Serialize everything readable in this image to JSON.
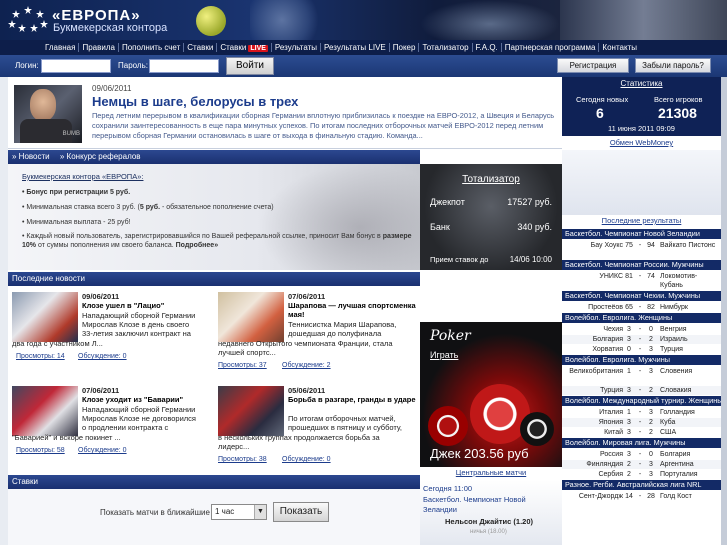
{
  "header": {
    "logo_title": "«ЕВРОПА»",
    "logo_sub": "Букмекерская контора"
  },
  "nav": {
    "items": [
      "Главная",
      "Правила",
      "Пополнить счет",
      "Ставки",
      "Ставки",
      "Результаты",
      "Результаты LIVE",
      "Покер",
      "Тотализатор",
      "F.A.Q.",
      "Партнерская программа",
      "Контакты"
    ],
    "live_badge": "LIVE"
  },
  "login": {
    "login_label": "Логин:",
    "password_label": "Пароль:",
    "submit": "Войти",
    "register": "Регистрация",
    "forgot": "Забыли пароль?"
  },
  "featured": {
    "date": "09/06/2011",
    "title": "Немцы в шаге, белорусы в трех",
    "text": "Перед летним перерывом в квалификации сборная Германии вплотную приблизилась к поездке на ЕВРО-2012, а Швеция и Беларусь сохранили заинтересованность в еще пара минутных успехов. По итогам последних отборочных матчей ЕВРО-2012 перед летним перерывом сборная Германии остановилась в шаге от выхода в финальную стадию. Команда...",
    "img_text": "BUMB"
  },
  "tabs": [
    "» Новости",
    "» Конкурс рефералов"
  ],
  "promo": {
    "title": "Букмекерская контора «ЕВРОПА»:",
    "line1": "• Бонус при регистрации 5 руб.",
    "line2a": "• Минимальная ставка всего 3 руб. (",
    "line2b": "5 руб.",
    "line2c": " - обязательное пополнение счета)",
    "line3": "• Минимальная выплата - 25 руб!",
    "line4a": "• Каждый новый пользователь, зарегистрировавшийся по Вашей реферальной ссылке, приносит Вам бонус в ",
    "line4b": "размере 10%",
    "line4c": " от суммы пополнения им своего баланса. ",
    "line4d": "Подробнее»"
  },
  "totalizator": {
    "title": "Тотализатор",
    "jackpot_label": "Джекпот",
    "jackpot_value": "17527 руб.",
    "bank_label": "Банк",
    "bank_value": "340 руб.",
    "accept_label": "Прием ставок до",
    "accept_value": "14/06 10:00"
  },
  "news_bar": "Последние новости",
  "news": [
    {
      "date": "09/06/2011",
      "title": "Клозе ушел в \"Лацио\"",
      "text1": "Нападающий сборной Германии",
      "text2": "Мирослав Клозе в день своего",
      "text3": "33-летия заключил контракт на",
      "text4": "два года с участником Л...",
      "views": "Просмотры: 14",
      "comments": "Обсуждение: 0"
    },
    {
      "date": "07/06/2011",
      "title": "Шарапова — лучшая спортсменка мая!",
      "text1": "Теннисистка Мария Шарапова,",
      "text2": "дошедшая до полуфинала",
      "text3": "недавнего Открытого чемпионата Франции, стала",
      "text4": "лучшей спортс...",
      "views": "Просмотры: 37",
      "comments": "Обсуждение: 2"
    },
    {
      "date": "07/06/2011",
      "title": "Клозе уходит из \"Баварии\"",
      "text1": "Нападающий сборной Германии",
      "text2": "Мирослав Клозе не договорился",
      "text3": "о продлении контракта с",
      "text4": "\"Баварией\" и вскоре покинет ...",
      "views": "Просмотры: 58",
      "comments": "Обсуждение: 0"
    },
    {
      "date": "05/06/2011",
      "title": "Борьба в разгаре, гранды в ударе",
      "text1": "По итогам отборочных матчей,",
      "text2": "прошедших в пятницу и субботу,",
      "text3": "в нескольких группах продолжается борьба за",
      "text4": "лидерс...",
      "views": "Просмотры: 38",
      "comments": "Обсуждение: 0"
    }
  ],
  "poker": {
    "title": "Poker",
    "play": "Играть",
    "jackpot": "Джек 203.56 руб"
  },
  "center": {
    "link": "Центральные матчи",
    "today": "Сегодня 11:00",
    "league": "Баскетбол. Чемпионат Новой",
    "league2": "Зеландии",
    "match": "Нельсон Джайтис (1.20)",
    "sub": "ничья (18.00)"
  },
  "bets": {
    "bar": "Ставки",
    "label": "Показать матчи в ближайшие",
    "select": "1 час",
    "show": "Показать"
  },
  "stats": {
    "link": "Статистика",
    "new_today_label": "Сегодня новых",
    "new_today": "6",
    "total_label": "Всего игроков",
    "total": "21308",
    "date": "11 июня 2011 09:09"
  },
  "webmoney": "Обмен WebMoney",
  "results_link": "Последние результаты",
  "results": [
    {
      "header": "Баскетбол. Чемпионат Новой Зеландии",
      "rows": [
        [
          "Бау Хоукс",
          "75",
          "94",
          "Вайкато Пистонс"
        ]
      ]
    },
    {
      "header": "Баскетбол. Чемпионат России. Мужчины",
      "rows": [
        [
          "УНИКС",
          "81",
          "74",
          "Локомотив-Кубань"
        ]
      ]
    },
    {
      "header": "Баскетбол. Чемпионат Чехии. Мужчины",
      "rows": [
        [
          "Простеёов",
          "65",
          "82",
          "Нимбурк"
        ]
      ]
    },
    {
      "header": "Волейбол. Евролига. Женщины",
      "rows": [
        [
          "Чехия",
          "3",
          "0",
          "Венгрия"
        ],
        [
          "Болгария",
          "3",
          "2",
          "Израиль"
        ],
        [
          "Хорватия",
          "0",
          "3",
          "Турция"
        ]
      ]
    },
    {
      "header": "Волейбол. Евролига. Мужчины",
      "rows": [
        [
          "Великобритания",
          "1",
          "3",
          "Словения"
        ],
        [
          "Турция",
          "3",
          "2",
          "Словакия"
        ]
      ]
    },
    {
      "header": "Волейбол. Международный турнир. Женщины",
      "rows": [
        [
          "Италия",
          "1",
          "3",
          "Голландия"
        ],
        [
          "Япония",
          "3",
          "2",
          "Куба"
        ],
        [
          "Китай",
          "3",
          "2",
          "США"
        ]
      ]
    },
    {
      "header": "Волейбол. Мировая лига. Мужчины",
      "rows": [
        [
          "Россия",
          "3",
          "0",
          "Болгария"
        ],
        [
          "Финляндия",
          "2",
          "3",
          "Аргентина"
        ],
        [
          "Сербия",
          "2",
          "3",
          "Португалия"
        ]
      ]
    },
    {
      "header": "Разное. Регби. Австралийская лига NRL",
      "rows": [
        [
          "Сент-Джордж",
          "14",
          "28",
          "Голд Кост"
        ]
      ]
    }
  ]
}
